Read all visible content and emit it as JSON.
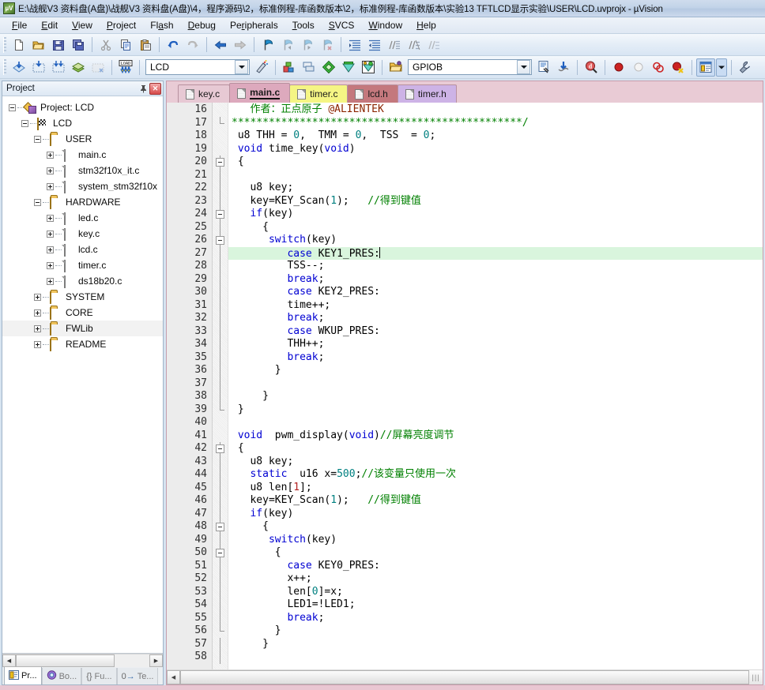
{
  "window": {
    "icon": "uvision-logo-icon",
    "title": "E:\\战舰V3 资料盘(A盘)\\战舰V3 资料盘(A盘)\\4，程序源码\\2，标准例程-库函数版本\\2，标准例程-库函数版本\\实验13 TFTLCD显示实验\\USER\\LCD.uvprojx - µVision"
  },
  "menu": {
    "items": [
      {
        "label": "File"
      },
      {
        "label": "Edit"
      },
      {
        "label": "View"
      },
      {
        "label": "Project"
      },
      {
        "label": "Flash"
      },
      {
        "label": "Debug"
      },
      {
        "label": "Peripherals"
      },
      {
        "label": "Tools"
      },
      {
        "label": "SVCS"
      },
      {
        "label": "Window"
      },
      {
        "label": "Help"
      }
    ]
  },
  "toolbar_file": {
    "buttons": [
      {
        "name": "new-file-icon",
        "title": "New"
      },
      {
        "name": "open-file-icon",
        "title": "Open"
      },
      {
        "name": "save-icon",
        "title": "Save"
      },
      {
        "name": "save-all-icon",
        "title": "Save All"
      },
      {
        "name": "cut-icon",
        "title": "Cut"
      },
      {
        "name": "copy-icon",
        "title": "Copy"
      },
      {
        "name": "paste-icon",
        "title": "Paste"
      },
      {
        "name": "undo-icon",
        "title": "Undo"
      },
      {
        "name": "redo-icon",
        "title": "Redo"
      },
      {
        "name": "navigate-back-icon",
        "title": "Back"
      },
      {
        "name": "navigate-forward-icon",
        "title": "Forward"
      },
      {
        "name": "bookmark-toggle-icon",
        "title": "Insert/Remove Bookmark"
      },
      {
        "name": "bookmark-prev-icon",
        "title": "Previous Bookmark"
      },
      {
        "name": "bookmark-next-icon",
        "title": "Next Bookmark"
      },
      {
        "name": "bookmark-clear-icon",
        "title": "Clear All Bookmarks"
      },
      {
        "name": "indent-right-icon",
        "title": "Indent"
      },
      {
        "name": "indent-left-icon",
        "title": "Unindent"
      },
      {
        "name": "comment-icon",
        "title": "Comment"
      },
      {
        "name": "uncomment-icon",
        "title": "Uncomment"
      }
    ]
  },
  "toolbar_build": {
    "buttons": [
      {
        "name": "translate-icon",
        "title": "Translate"
      },
      {
        "name": "build-icon",
        "title": "Build"
      },
      {
        "name": "rebuild-icon",
        "title": "Rebuild"
      },
      {
        "name": "batch-build-icon",
        "title": "Batch Build"
      },
      {
        "name": "stop-build-icon",
        "title": "Stop Build"
      },
      {
        "name": "download-icon",
        "title": "Download"
      }
    ],
    "target_select": {
      "name": "target-combo",
      "value": "LCD",
      "placeholder": "Select Target"
    },
    "after_target": [
      {
        "name": "target-options-icon",
        "title": "Target Options"
      },
      {
        "name": "manage-project-items-icon",
        "title": "Manage Project Items"
      },
      {
        "name": "manage-components-icon",
        "title": "Manage Components"
      },
      {
        "name": "pack-installer-icon",
        "title": "Pack Installer"
      },
      {
        "name": "manage-run-time-icon",
        "title": "Manage Run-Time Environment"
      },
      {
        "name": "select-software-packs-icon",
        "title": "Select Software Packs"
      }
    ]
  },
  "toolbar_debug": {
    "open_icon": {
      "name": "open-folder-icon",
      "title": "Open"
    },
    "peripheral_select": {
      "name": "peripheral-combo",
      "value": "GPIOB",
      "placeholder": "Select Peripheral"
    },
    "buttons": [
      {
        "name": "source-browse-icon",
        "title": "Source Browse"
      },
      {
        "name": "debug-settings-icon",
        "title": "Debug Settings"
      },
      {
        "name": "find-in-files-icon",
        "title": "Find in Files"
      },
      {
        "name": "breakpoint-insert-icon",
        "title": "Insert/Remove Breakpoint"
      },
      {
        "name": "breakpoint-enable-icon",
        "title": "Enable/Disable Breakpoint"
      },
      {
        "name": "breakpoint-disable-all-icon",
        "title": "Disable All Breakpoints"
      },
      {
        "name": "breakpoint-kill-all-icon",
        "title": "Kill All Breakpoints"
      },
      {
        "name": "window-layout-icon",
        "title": "Window Layout"
      },
      {
        "name": "layout-dropdown-icon",
        "title": "Layout Options"
      },
      {
        "name": "configure-icon",
        "title": "Configuration Wizard"
      }
    ]
  },
  "project_panel": {
    "title": "Project",
    "pin_icon": "pin-icon",
    "close_icon": "close-icon",
    "tree": [
      {
        "label": "Project: LCD",
        "depth": 0,
        "icon": "project-icon",
        "expander": "minus"
      },
      {
        "label": "LCD",
        "depth": 1,
        "icon": "target-icon",
        "expander": "minus"
      },
      {
        "label": "USER",
        "depth": 2,
        "icon": "folder-icon",
        "expander": "minus"
      },
      {
        "label": "main.c",
        "depth": 3,
        "icon": "file-icon",
        "expander": "plus"
      },
      {
        "label": "stm32f10x_it.c",
        "depth": 3,
        "icon": "file-icon",
        "expander": "plus"
      },
      {
        "label": "system_stm32f10x",
        "depth": 3,
        "icon": "file-icon",
        "expander": "plus"
      },
      {
        "label": "HARDWARE",
        "depth": 2,
        "icon": "folder-icon",
        "expander": "minus"
      },
      {
        "label": "led.c",
        "depth": 3,
        "icon": "file-icon",
        "expander": "plus"
      },
      {
        "label": "key.c",
        "depth": 3,
        "icon": "file-icon",
        "expander": "plus"
      },
      {
        "label": "lcd.c",
        "depth": 3,
        "icon": "file-icon",
        "expander": "plus"
      },
      {
        "label": "timer.c",
        "depth": 3,
        "icon": "file-icon",
        "expander": "plus"
      },
      {
        "label": "ds18b20.c",
        "depth": 3,
        "icon": "file-icon",
        "expander": "plus"
      },
      {
        "label": "SYSTEM",
        "depth": 2,
        "icon": "folder-icon",
        "expander": "plus"
      },
      {
        "label": "CORE",
        "depth": 2,
        "icon": "folder-icon",
        "expander": "plus"
      },
      {
        "label": "FWLib",
        "depth": 2,
        "icon": "folder-icon",
        "expander": "plus",
        "selected": true
      },
      {
        "label": "README",
        "depth": 2,
        "icon": "folder-icon",
        "expander": "plus"
      }
    ],
    "bottom_tabs": [
      {
        "label": "Pr...",
        "icon": "project-tab-icon",
        "active": true
      },
      {
        "label": "Bo...",
        "icon": "books-tab-icon",
        "active": false
      },
      {
        "label": "Fu...",
        "icon": "functions-tab-icon",
        "active": false
      },
      {
        "label": "Te...",
        "icon": "templates-tab-icon",
        "active": false
      }
    ]
  },
  "editor": {
    "tabs": [
      {
        "label": "key.c",
        "color": "#e7c9d4",
        "active": false
      },
      {
        "label": "main.c",
        "color": "#dda9bd",
        "active": true
      },
      {
        "label": "timer.c",
        "color": "#f5f584",
        "active": false
      },
      {
        "label": "lcd.h",
        "color": "#c4787d",
        "active": false
      },
      {
        "label": "timer.h",
        "color": "#cdb3e6",
        "active": false
      }
    ],
    "first_line": 16,
    "current_line": 27,
    "scrollbar_grip_icon": "resize-grip-icon",
    "lines": [
      {
        "n": 16,
        "fold": "",
        "html": "   <span class=\"cmt\">作者：正点原子</span> <span class=\"at\">@ALIENTEK</span>"
      },
      {
        "n": 17,
        "fold": "end",
        "html": "<span class=\"cmt\">***********************************************/</span>"
      },
      {
        "n": 18,
        "fold": "",
        "html": " u8 THH = <span class=\"num\">0</span>,  TMM = <span class=\"num\">0</span>,  TSS  = <span class=\"num\">0</span>;"
      },
      {
        "n": 19,
        "fold": "",
        "html": " <span class=\"kw\">void</span> time_key(<span class=\"kw\">void</span>)"
      },
      {
        "n": 20,
        "fold": "box",
        "html": " {"
      },
      {
        "n": 21,
        "fold": "line",
        "html": ""
      },
      {
        "n": 22,
        "fold": "line",
        "html": "   u8 key;"
      },
      {
        "n": 23,
        "fold": "line",
        "html": "   key=KEY_Scan(<span class=\"num\">1</span>);   <span class=\"cmt\">//得到键值</span>"
      },
      {
        "n": 24,
        "fold": "box",
        "html": "   <span class=\"kw\">if</span>(key)"
      },
      {
        "n": 25,
        "fold": "line",
        "html": "     {"
      },
      {
        "n": 26,
        "fold": "box",
        "html": "      <span class=\"kw\">switch</span>(key)"
      },
      {
        "n": 27,
        "fold": "line",
        "html": "       {",
        "current": false
      },
      {
        "n": 28,
        "fold": "line",
        "html": "         TSS--;"
      },
      {
        "n": 29,
        "fold": "line",
        "html": "         <span class=\"kw\">break</span>;"
      },
      {
        "n": 30,
        "fold": "line",
        "html": "         <span class=\"kw\">case</span> KEY2_PRES:"
      },
      {
        "n": 31,
        "fold": "line",
        "html": "         time++;"
      },
      {
        "n": 32,
        "fold": "line",
        "html": "         <span class=\"kw\">break</span>;"
      },
      {
        "n": 33,
        "fold": "line",
        "html": "         <span class=\"kw\">case</span> WKUP_PRES:"
      },
      {
        "n": 34,
        "fold": "line",
        "html": "         THH++;"
      },
      {
        "n": 35,
        "fold": "line",
        "html": "         <span class=\"kw\">break</span>;"
      },
      {
        "n": 36,
        "fold": "line",
        "html": "       }"
      },
      {
        "n": 37,
        "fold": "line",
        "html": ""
      },
      {
        "n": 38,
        "fold": "line",
        "html": "     }"
      },
      {
        "n": 39,
        "fold": "end",
        "html": " }"
      },
      {
        "n": 40,
        "fold": "",
        "html": ""
      },
      {
        "n": 41,
        "fold": "",
        "html": " <span class=\"kw\">void</span>  pwm_display(<span class=\"kw\">void</span>)<span class=\"cmt\">//屏幕亮度调节</span>"
      },
      {
        "n": 42,
        "fold": "box",
        "html": " {"
      },
      {
        "n": 43,
        "fold": "line",
        "html": "   u8 key;"
      },
      {
        "n": 44,
        "fold": "line",
        "html": "   <span class=\"kw\">static</span>  u16 x=<span class=\"num\">500</span>;<span class=\"cmt\">//该变量只使用一次</span>"
      },
      {
        "n": 45,
        "fold": "line",
        "html": "   u8 len[<span class=\"numr\">1</span>];"
      },
      {
        "n": 46,
        "fold": "line",
        "html": "   key=KEY_Scan(<span class=\"num\">1</span>);   <span class=\"cmt\">//得到键值</span>"
      },
      {
        "n": 47,
        "fold": "line",
        "html": "   <span class=\"kw\">if</span>(key)"
      },
      {
        "n": 48,
        "fold": "box",
        "html": "     {"
      },
      {
        "n": 49,
        "fold": "line",
        "html": "      <span class=\"kw\">switch</span>(key)"
      },
      {
        "n": 50,
        "fold": "box",
        "html": "       {"
      },
      {
        "n": 51,
        "fold": "line",
        "html": "         <span class=\"kw\">case</span> KEY0_PRES:"
      },
      {
        "n": 52,
        "fold": "line",
        "html": "         x++;"
      },
      {
        "n": 53,
        "fold": "line",
        "html": "         len[<span class=\"num\">0</span>]=x;"
      },
      {
        "n": 54,
        "fold": "line",
        "html": "         LED1=!LED1;"
      },
      {
        "n": 55,
        "fold": "line",
        "html": "         <span class=\"kw\">break</span>;"
      },
      {
        "n": 56,
        "fold": "end",
        "html": "       }"
      },
      {
        "n": 57,
        "fold": "line",
        "html": "     }"
      },
      {
        "n": 58,
        "fold": "line",
        "html": ""
      }
    ],
    "current_line_html": "         <span class=\"kw\">case</span> KEY1_PRES:"
  },
  "colors": {
    "keyword": "#0000d2",
    "comment": "#008000",
    "number": "#008080",
    "current_line_bg": "#d9f5dd",
    "editor_frame": "#e5c4cf"
  }
}
